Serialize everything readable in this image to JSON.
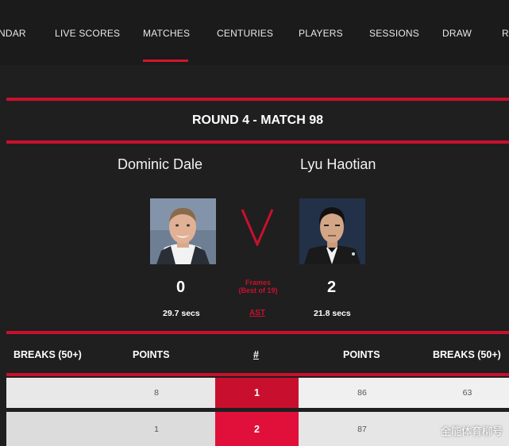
{
  "nav": {
    "items": [
      "NDAR",
      "LIVE SCORES",
      "MATCHES",
      "CENTURIES",
      "PLAYERS",
      "SESSIONS",
      "DRAW",
      "R"
    ],
    "active": "MATCHES"
  },
  "match": {
    "title": "ROUND 4 - MATCH 98",
    "player1": {
      "name": "Dominic Dale",
      "score": "0",
      "avg_shot_time": "29.7 secs"
    },
    "player2": {
      "name": "Lyu Haotian",
      "score": "2",
      "avg_shot_time": "21.8 secs"
    },
    "vs_label": "V",
    "frames_label": "Frames",
    "best_of": "(Best of 19)",
    "ast_label": "AST"
  },
  "table": {
    "headers": [
      "BREAKS (50+)",
      "POINTS",
      "#",
      "POINTS",
      "BREAKS (50+)"
    ],
    "rows": [
      {
        "p1_breaks": "",
        "p1_points": "8",
        "frame": "1",
        "p2_points": "86",
        "p2_breaks": "63"
      },
      {
        "p1_breaks": "",
        "p1_points": "1",
        "frame": "2",
        "p2_points": "87",
        "p2_breaks": ""
      }
    ]
  },
  "colors": {
    "accent": "#c8102e",
    "background": "#1f1f1f",
    "nav_bg": "#1b1b1b"
  },
  "watermark": "全能体育柳号"
}
